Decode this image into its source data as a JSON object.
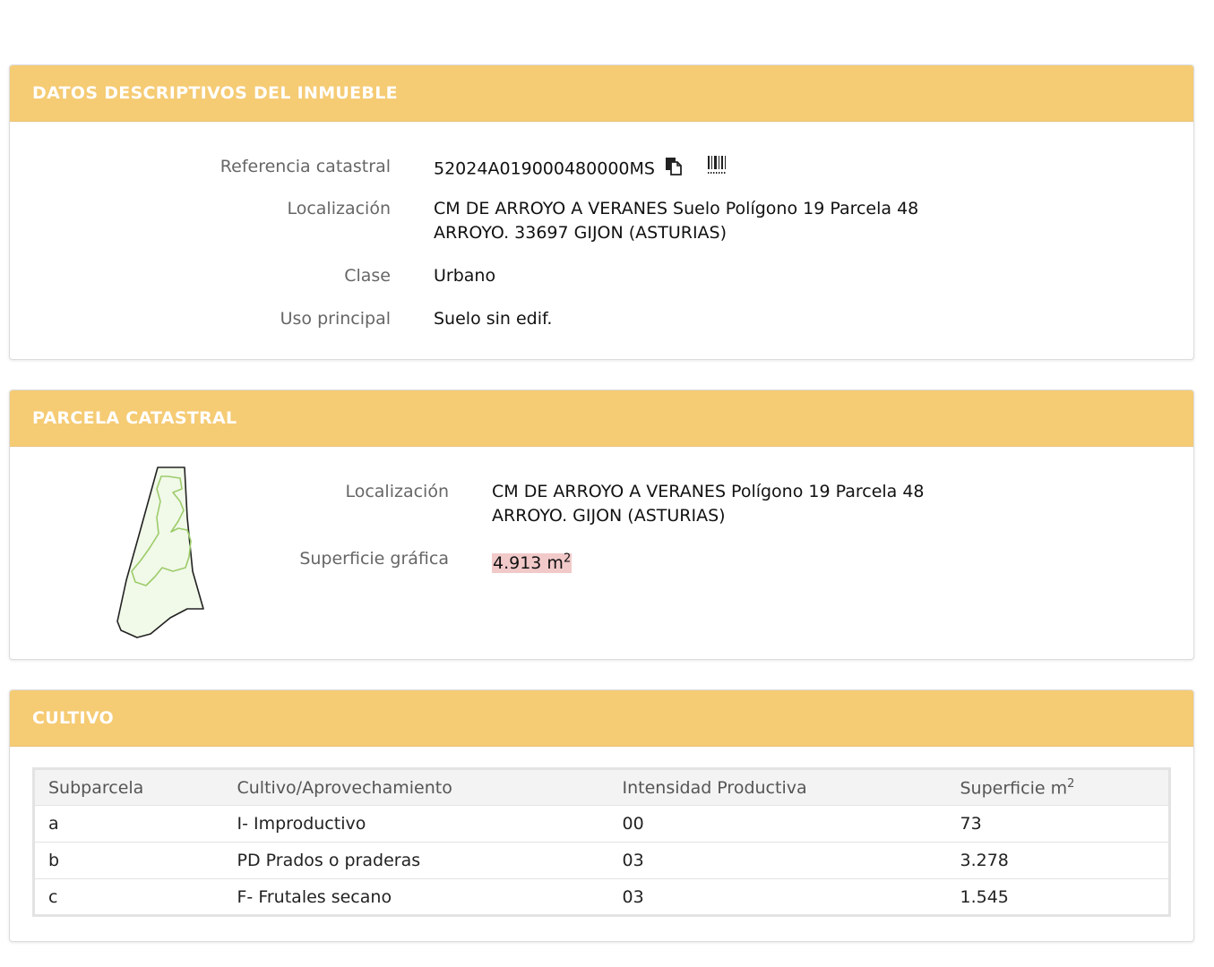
{
  "datos": {
    "title": "DATOS DESCRIPTIVOS DEL INMUEBLE",
    "referencia_label": "Referencia catastral",
    "referencia_value": "52024A019000480000MS",
    "copy_icon": "copy-icon",
    "barcode_icon": "barcode-icon",
    "localizacion_label": "Localización",
    "localizacion_line1": "CM DE ARROYO A VERANES Suelo Polígono 19 Parcela 48",
    "localizacion_line2": "ARROYO. 33697 GIJON (ASTURIAS)",
    "clase_label": "Clase",
    "clase_value": "Urbano",
    "uso_label": "Uso principal",
    "uso_value": "Suelo sin edif."
  },
  "parcela": {
    "title": "PARCELA CATASTRAL",
    "localizacion_label": "Localización",
    "localizacion_line1": "CM DE ARROYO A VERANES Polígono 19 Parcela 48",
    "localizacion_line2": "ARROYO. GIJON (ASTURIAS)",
    "superficie_label": "Superficie gráfica",
    "superficie_value": "4.913 m",
    "superficie_sup": "2"
  },
  "cultivo": {
    "title": "CULTIVO",
    "headers": {
      "subparcela": "Subparcela",
      "cultivo": "Cultivo/Aprovechamiento",
      "intensidad": "Intensidad Productiva",
      "superficie": "Superficie m",
      "superficie_sup": "2"
    },
    "rows": [
      {
        "subparcela": "a",
        "cultivo": "I- Improductivo",
        "intensidad": "00",
        "superficie": "73"
      },
      {
        "subparcela": "b",
        "cultivo": "PD Prados o praderas",
        "intensidad": "03",
        "superficie": "3.278"
      },
      {
        "subparcela": "c",
        "cultivo": "F- Frutales secano",
        "intensidad": "03",
        "superficie": "1.545"
      }
    ]
  },
  "colors": {
    "header_bg": "#f5cb74",
    "header_text": "#ffffff",
    "highlight": "#f2c9c9"
  }
}
